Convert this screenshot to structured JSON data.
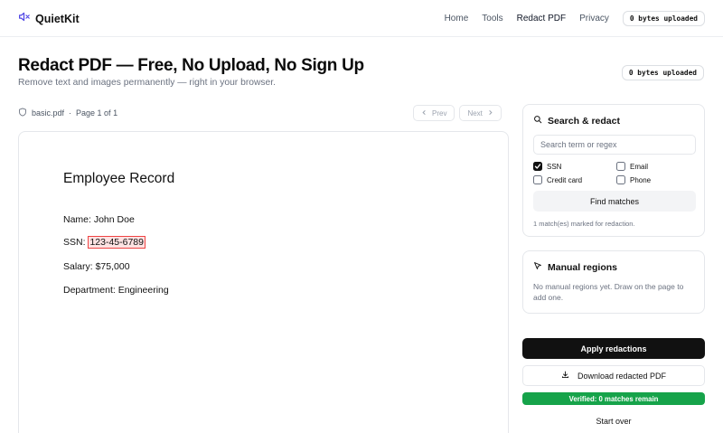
{
  "brand": {
    "name": "QuietKit",
    "icon": "speaker-muted-icon",
    "accent": "#4f46e5"
  },
  "nav": {
    "items": [
      {
        "label": "Home"
      },
      {
        "label": "Tools"
      },
      {
        "label": "Redact PDF"
      },
      {
        "label": "Privacy"
      }
    ],
    "active_index": 2,
    "upload_badge": "0 bytes uploaded"
  },
  "hero": {
    "title": "Redact PDF — Free, No Upload, No Sign Up",
    "subtitle": "Remove text and images permanently — right in your browser.",
    "upload_badge": "0 bytes uploaded"
  },
  "viewer": {
    "file_name": "basic.pdf",
    "separator": "·",
    "page_label": "Page 1 of 1",
    "prev_label": "Prev",
    "next_label": "Next"
  },
  "document": {
    "heading": "Employee Record",
    "name_line": "Name: John Doe",
    "ssn_prefix": "SSN: ",
    "ssn_value": "123-45-6789",
    "salary_line": "Salary: $75,000",
    "department_line": "Department: Engineering",
    "redaction_color": "#ef4444"
  },
  "search_panel": {
    "title": "Search & redact",
    "placeholder": "Search term or regex",
    "value": "",
    "options": [
      {
        "label": "SSN",
        "checked": true
      },
      {
        "label": "Email",
        "checked": false
      },
      {
        "label": "Credit card",
        "checked": false
      },
      {
        "label": "Phone",
        "checked": false
      }
    ],
    "find_label": "Find matches",
    "status": "1 match(es) marked for redaction."
  },
  "manual_panel": {
    "title": "Manual regions",
    "empty_text": "No manual regions yet. Draw on the page to add one."
  },
  "actions": {
    "apply_label": "Apply redactions",
    "download_label": "Download redacted PDF",
    "verified_label": "Verified: 0 matches remain",
    "verified_color": "#16a34a",
    "start_over_label": "Start over"
  }
}
